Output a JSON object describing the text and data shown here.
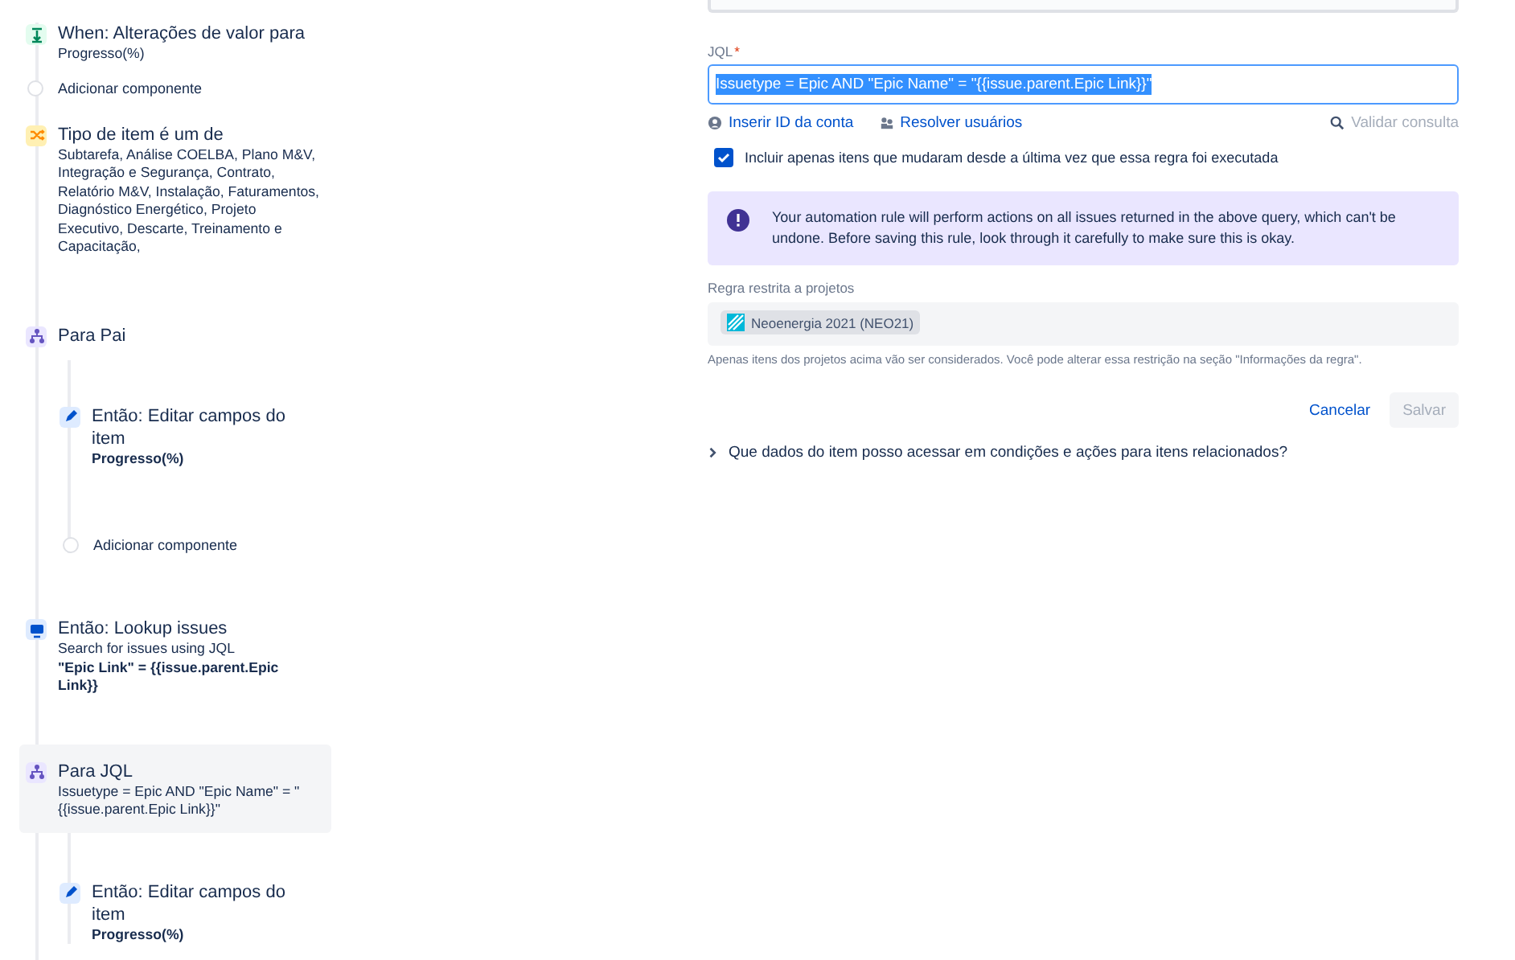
{
  "rule_flow": [
    {
      "kind": "trigger",
      "selected": false,
      "title": "When: Alterações de valor para",
      "lines": [
        "Progresso(%)"
      ]
    },
    {
      "kind": "add",
      "label": "Adicionar componente"
    },
    {
      "kind": "condition",
      "selected": false,
      "title": "Tipo de item é um de",
      "lines": [
        "Subtarefa, Análise COELBA, Plano M&V, Integração e Segurança, Contrato, Relatório M&V, Instalação, Faturamentos, Diagnóstico Energético, Projeto Executivo, Descarte, Treinamento e Capacitação,"
      ]
    },
    {
      "kind": "branch",
      "selected": false,
      "title": "Para Pai",
      "children": [
        {
          "kind": "edit",
          "selected": false,
          "title": "Então: Editar campos do item",
          "bold": "Progresso(%)"
        },
        {
          "kind": "add",
          "label": "Adicionar componente"
        }
      ]
    },
    {
      "kind": "lookup",
      "selected": false,
      "title": "Então: Lookup issues",
      "lines": [
        "Search for issues using JQL"
      ],
      "bold": "\"Epic Link\" = {{issue.parent.Epic Link}}"
    },
    {
      "kind": "branch",
      "selected": true,
      "title": "Para JQL",
      "lines": [
        "Issuetype = Epic AND \"Epic Name\" = \"{{issue.parent.Epic Link}}\""
      ],
      "children": [
        {
          "kind": "edit",
          "selected": false,
          "title": "Então: Editar campos do item",
          "bold": "Progresso(%)"
        }
      ]
    }
  ],
  "form": {
    "jql_label": "JQL",
    "required_mark": "*",
    "jql_value": "Issuetype = Epic AND \"Epic Name\" = \"{{issue.parent.Epic Link}}\"",
    "links": [
      "Inserir ID da conta",
      "Resolver usuários"
    ],
    "validate": "Validar consulta",
    "validate_disabled": true,
    "checkbox": {
      "label": "Incluir apenas itens que mudaram desde a última vez que essa regra foi executada",
      "checked": true
    },
    "warning": "Your automation rule will perform actions on all issues returned in the above query, which can't be undone. Before saving this rule, look through it carefully to make sure this is okay.",
    "projects_label": "Regra restrita a projetos",
    "project_chip": "Neoenergia 2021 (NEO21)",
    "projects_help": "Apenas itens dos projetos acima vão ser considerados. Você pode alterar essa restrição na seção \"Informações da regra\".",
    "cancel": "Cancelar",
    "save": "Salvar",
    "save_disabled": true,
    "expander": "Que dados do item posso acessar em condições e ações para itens relacionados?"
  }
}
